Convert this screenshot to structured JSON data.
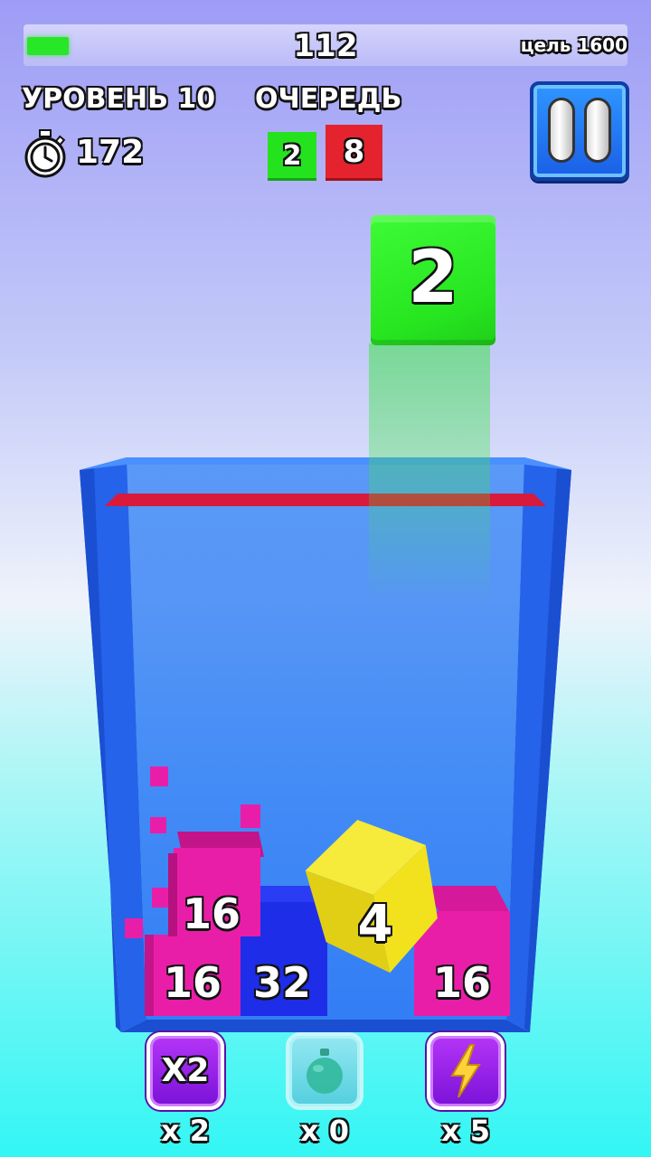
{
  "hud": {
    "score": "112",
    "goal": "цель 1600",
    "progress_fraction": 0.07,
    "level": "УРОВЕНЬ 10",
    "timer": "172",
    "queue_label": "ОЧЕРЕДЬ",
    "queue": [
      {
        "value": "2",
        "color": "#25e21f"
      },
      {
        "value": "8",
        "color": "#e5232e"
      }
    ]
  },
  "falling_cube": {
    "value": "2",
    "color": "#27e620"
  },
  "board": {
    "limit_line_color": "#d81b3c",
    "container_color": "#2f73f5",
    "cubes": [
      {
        "value": "16",
        "color": "#e91ea8"
      },
      {
        "value": "16",
        "color": "#e91ea8"
      },
      {
        "value": "32",
        "color": "#1e2de8"
      },
      {
        "value": "4",
        "color": "#f2e21e"
      },
      {
        "value": "16",
        "color": "#e91ea8"
      }
    ]
  },
  "boosters": [
    {
      "name": "x2",
      "label": "X2",
      "count": "x 2"
    },
    {
      "name": "bomb",
      "label": "",
      "count": "x 0"
    },
    {
      "name": "lightning",
      "label": "",
      "count": "x 5"
    }
  ],
  "colors": {
    "accent_blue": "#1a5fe6",
    "booster_purple": "#9a25e8"
  }
}
